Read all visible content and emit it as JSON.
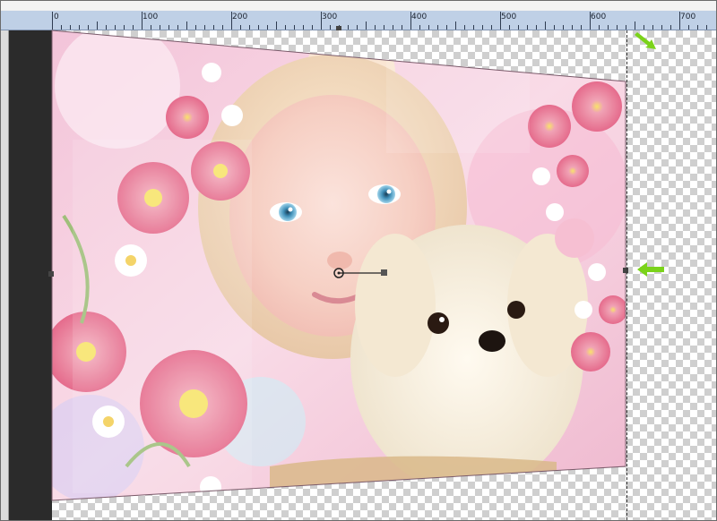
{
  "ruler": {
    "labels": [
      "0",
      "100",
      "200",
      "300",
      "400",
      "500",
      "600",
      "700"
    ]
  },
  "canvas": {
    "layer_description_icons": [
      "girl-portrait",
      "white-puppy",
      "pink-flowers"
    ]
  },
  "colors": {
    "ruler_bg": "#bfd0e6",
    "accent_arrow": "#7bd31a",
    "panel": "#2b2b2b"
  }
}
